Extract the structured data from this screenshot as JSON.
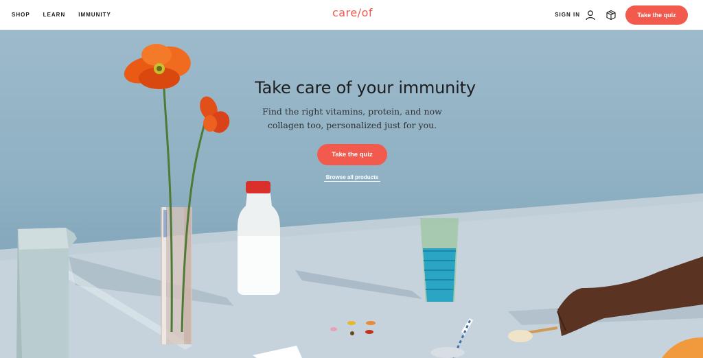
{
  "header": {
    "nav": [
      {
        "label": "SHOP"
      },
      {
        "label": "LEARN"
      },
      {
        "label": "IMMUNITY"
      }
    ],
    "logo": "care/of",
    "signin": "SIGN IN",
    "quiz_label": "Take the quiz"
  },
  "hero": {
    "title": "Take care of your immunity",
    "subtitle": "Find the right vitamins, protein, and now collagen too, personalized just for you.",
    "quiz_label": "Take the quiz",
    "browse_label": "Browse all products"
  },
  "colors": {
    "accent": "#f25a4e",
    "logo": "#ef5a4d",
    "hero_bg": "#8fb1c3"
  },
  "icons": [
    "user-icon",
    "box-icon"
  ]
}
